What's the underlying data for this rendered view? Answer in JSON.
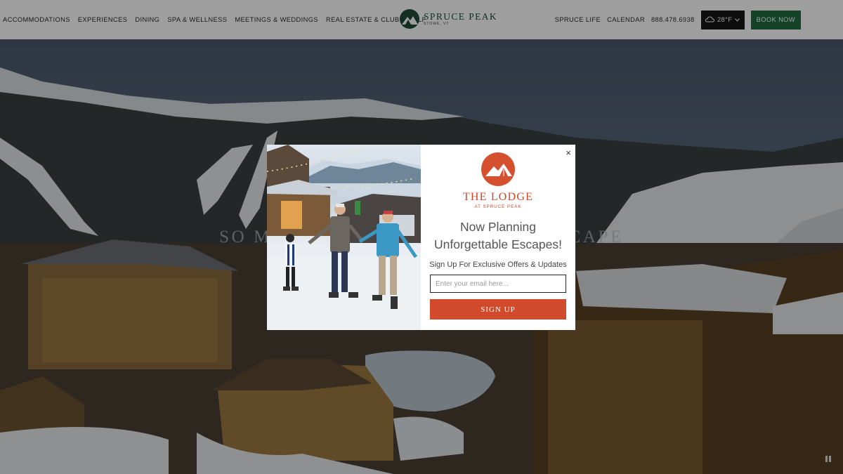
{
  "header": {
    "nav_left": [
      "ACCOMMODATIONS",
      "EXPERIENCES",
      "DINING",
      "SPA & WELLNESS",
      "MEETINGS & WEDDINGS",
      "REAL ESTATE & CLUB",
      "GOLF"
    ],
    "logo_name": "SPRUCE PEAK",
    "logo_location": "STOWE, VT",
    "nav_right": [
      "SPRUCE LIFE",
      "CALENDAR",
      "888.478.6938"
    ],
    "weather": "28°F",
    "book_label": "BOOK NOW"
  },
  "hero": {
    "headline": "SO MUCH SNOW, S                                    UR WINTER ESCAPE"
  },
  "modal": {
    "brand_title": "THE LODGE",
    "brand_sub": "AT SPRUCE PEAK",
    "headline_line1": "Now Planning",
    "headline_line2": "Unforgettable Escapes!",
    "offers_text": "Sign Up For Exclusive Offers & Updates",
    "email_placeholder": "Enter your email here...",
    "signup_label": "SIGN UP",
    "close_icon": "×"
  },
  "colors": {
    "brand_green": "#1f4d3a",
    "lodge_orange": "#d24a2c",
    "book_green": "#1f6b43"
  }
}
